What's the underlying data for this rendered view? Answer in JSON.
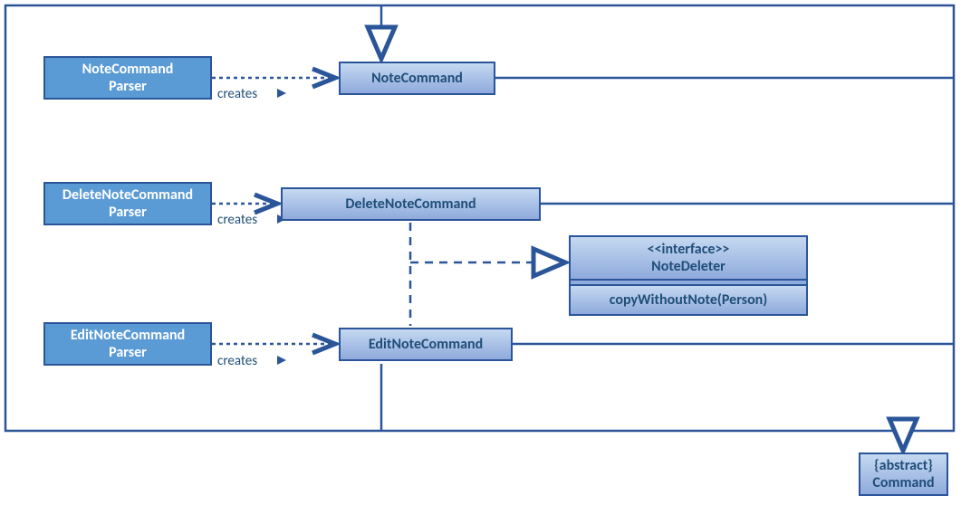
{
  "parsers": {
    "note": {
      "l1": "NoteCommand",
      "l2": "Parser"
    },
    "delete": {
      "l1": "DeleteNoteCommand",
      "l2": "Parser"
    },
    "edit": {
      "l1": "EditNoteCommand",
      "l2": "Parser"
    }
  },
  "commands": {
    "note": "NoteCommand",
    "delete": "DeleteNoteCommand",
    "edit": "EditNoteCommand"
  },
  "interface": {
    "stereotype": "<<interface>>",
    "name": "NoteDeleter",
    "method": "copyWithoutNote(Person)"
  },
  "abstract": {
    "stereotype": "{abstract}",
    "name": "Command"
  },
  "labels": {
    "creates": "creates"
  },
  "chart_data": {
    "type": "uml-class-diagram",
    "classes": [
      {
        "id": "NoteCommandParser",
        "type": "class"
      },
      {
        "id": "DeleteNoteCommandParser",
        "type": "class"
      },
      {
        "id": "EditNoteCommandParser",
        "type": "class"
      },
      {
        "id": "NoteCommand",
        "type": "class"
      },
      {
        "id": "DeleteNoteCommand",
        "type": "class"
      },
      {
        "id": "EditNoteCommand",
        "type": "class"
      },
      {
        "id": "NoteDeleter",
        "type": "interface",
        "methods": [
          "copyWithoutNote(Person)"
        ]
      },
      {
        "id": "Command",
        "type": "abstract"
      }
    ],
    "relations": [
      {
        "from": "NoteCommandParser",
        "to": "NoteCommand",
        "kind": "dependency",
        "label": "creates"
      },
      {
        "from": "DeleteNoteCommandParser",
        "to": "DeleteNoteCommand",
        "kind": "dependency",
        "label": "creates"
      },
      {
        "from": "EditNoteCommandParser",
        "to": "EditNoteCommand",
        "kind": "dependency",
        "label": "creates"
      },
      {
        "from": "NoteCommand",
        "to": "Command",
        "kind": "generalization"
      },
      {
        "from": "DeleteNoteCommand",
        "to": "Command",
        "kind": "generalization"
      },
      {
        "from": "EditNoteCommand",
        "to": "Command",
        "kind": "generalization"
      },
      {
        "from": "DeleteNoteCommand",
        "to": "NoteDeleter",
        "kind": "realization"
      },
      {
        "from": "EditNoteCommand",
        "to": "NoteDeleter",
        "kind": "realization"
      }
    ]
  }
}
